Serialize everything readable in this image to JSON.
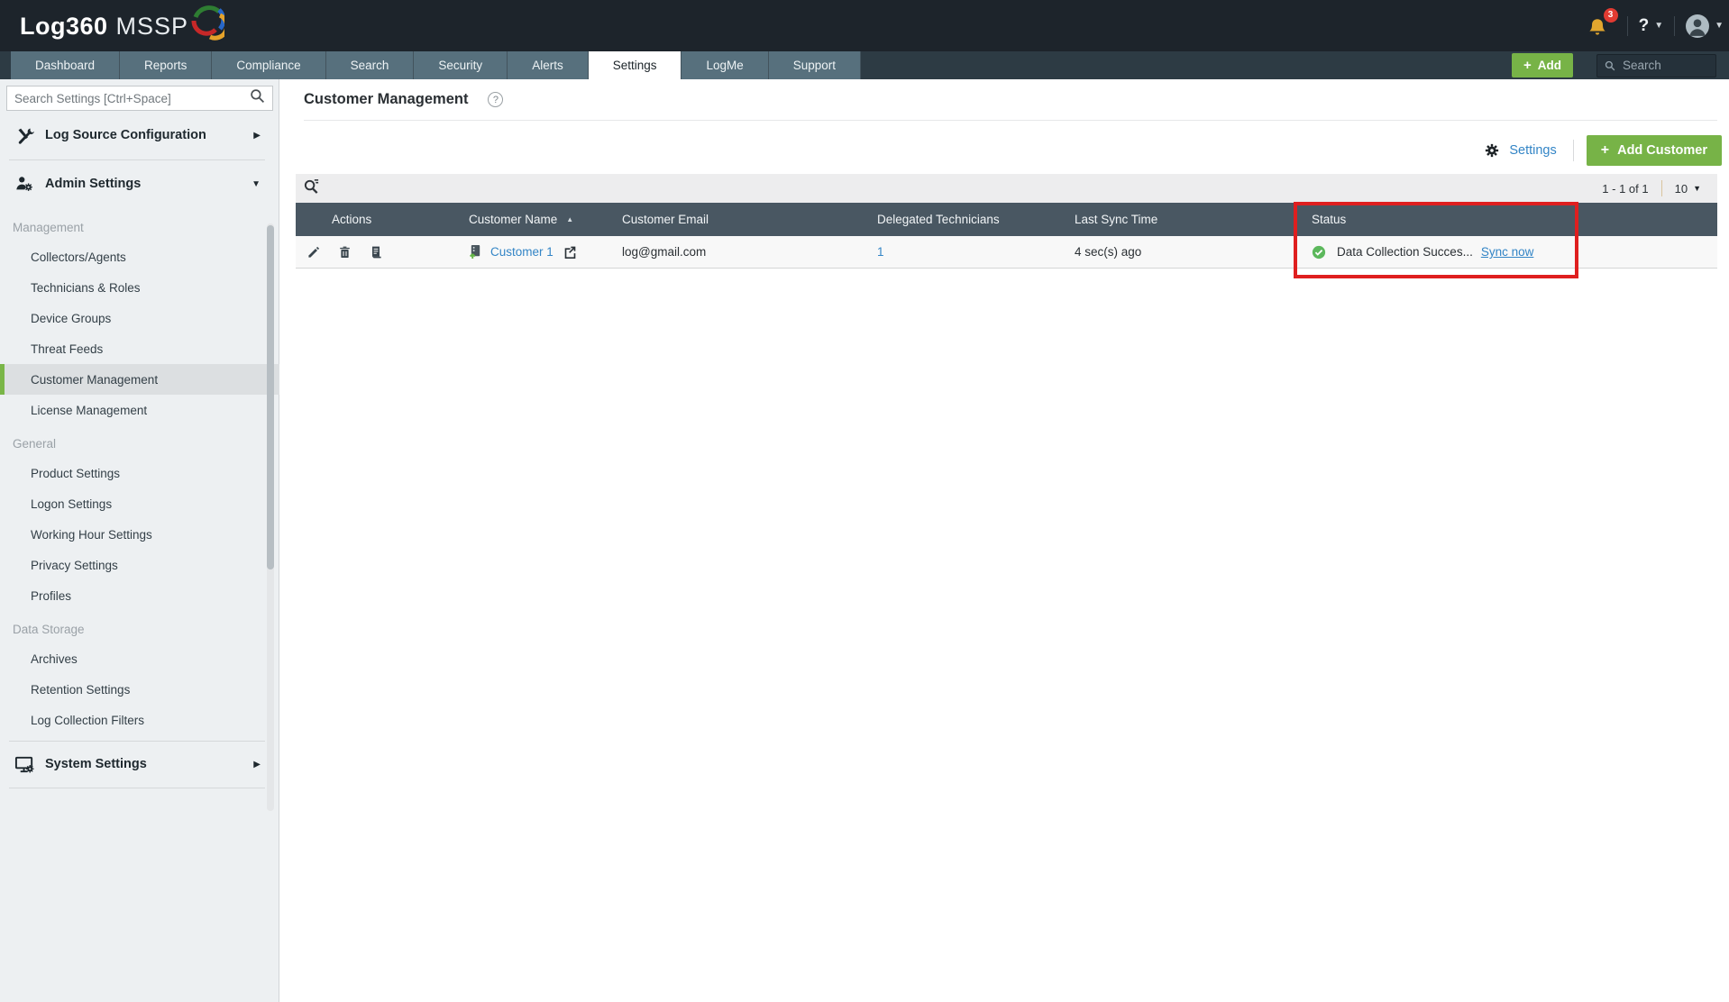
{
  "colors": {
    "accent_green": "#77b347",
    "link_blue": "#3385c6",
    "status_green": "#5cb85c",
    "highlight_red": "#df1f1f",
    "header_dark": "#495762",
    "topbar_dark": "#1d242b"
  },
  "topbar": {
    "logo_primary": "Log360",
    "logo_secondary": "MSSP",
    "notification_count": "3",
    "help_label": "?"
  },
  "tabbar": {
    "tabs": [
      {
        "label": "Dashboard"
      },
      {
        "label": "Reports"
      },
      {
        "label": "Compliance"
      },
      {
        "label": "Search"
      },
      {
        "label": "Security"
      },
      {
        "label": "Alerts"
      },
      {
        "label": "Settings"
      },
      {
        "label": "LogMe"
      },
      {
        "label": "Support"
      }
    ],
    "active_tab": "Settings",
    "add_button_label": "Add",
    "search_placeholder": "Search"
  },
  "sidebar": {
    "search_placeholder": "Search Settings [Ctrl+Space]",
    "top_items": [
      {
        "label": "Log Source Configuration",
        "icon": "tools-icon"
      },
      {
        "label": "Admin Settings",
        "icon": "admin-user-gear-icon"
      }
    ],
    "groups": [
      {
        "label": "Management",
        "items": [
          "Collectors/Agents",
          "Technicians & Roles",
          "Device Groups",
          "Threat Feeds",
          "Customer Management",
          "License Management"
        ],
        "selected": "Customer Management"
      },
      {
        "label": "General",
        "items": [
          "Product Settings",
          "Logon Settings",
          "Working Hour Settings",
          "Privacy Settings",
          "Profiles"
        ]
      },
      {
        "label": "Data Storage",
        "items": [
          "Archives",
          "Retention Settings",
          "Log Collection Filters"
        ]
      }
    ],
    "bottom_item": {
      "label": "System Settings",
      "icon": "monitor-gear-icon"
    }
  },
  "main": {
    "page_title": "Customer Management",
    "help_icon": "?",
    "settings_link_label": "Settings",
    "add_customer_label": "Add Customer",
    "pager": {
      "range": "1 - 1 of 1",
      "page_size": "10"
    },
    "table": {
      "columns": [
        "Actions",
        "Customer Name",
        "Customer Email",
        "Delegated Technicians",
        "Last Sync Time",
        "Status"
      ],
      "sorted_column": "Customer Name",
      "row": {
        "action_icons": [
          "edit-icon",
          "delete-icon",
          "report-icon"
        ],
        "customer_name": "Customer 1",
        "customer_email": "log@gmail.com",
        "delegated_technicians": "1",
        "last_sync_time": "4 sec(s) ago",
        "status_icon": "check-circle",
        "status_text": "Data Collection Succes...",
        "sync_link": "Sync now"
      }
    }
  }
}
